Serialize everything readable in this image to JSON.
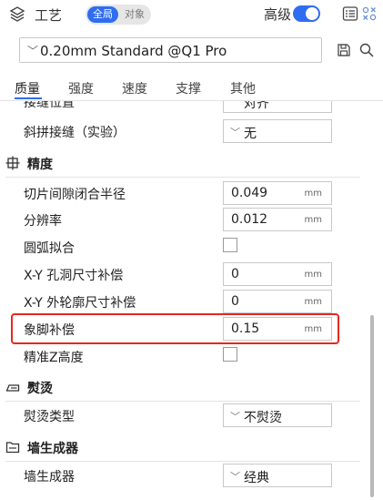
{
  "header": {
    "title": "工艺",
    "scope_options": [
      "全局",
      "对象"
    ],
    "scope_selected": "全局",
    "advanced_label": "高级",
    "advanced_enabled": true
  },
  "preset": {
    "value": "0.20mm Standard @Q1 Pro"
  },
  "tabs": [
    {
      "label": "质量",
      "active": true
    },
    {
      "label": "强度",
      "active": false
    },
    {
      "label": "速度",
      "active": false
    },
    {
      "label": "支撑",
      "active": false
    },
    {
      "label": "其他",
      "active": false
    }
  ],
  "rows": {
    "seam_position": {
      "label": "接缝位置",
      "value": "对齐"
    },
    "scarf_seam": {
      "label": "斜拼接缝（实验）",
      "value": "无"
    },
    "precision_section": "精度",
    "slice_gap_closing": {
      "label": "切片间隙闭合半径",
      "value": "0.049",
      "unit": "mm"
    },
    "resolution": {
      "label": "分辨率",
      "value": "0.012",
      "unit": "mm"
    },
    "arc_fitting": {
      "label": "圆弧拟合",
      "checked": false
    },
    "xy_hole_comp": {
      "label": "X-Y 孔洞尺寸补偿",
      "value": "0",
      "unit": "mm"
    },
    "xy_contour_comp": {
      "label": "X-Y 外轮廓尺寸补偿",
      "value": "0",
      "unit": "mm"
    },
    "elephant_foot": {
      "label": "象脚补偿",
      "value": "0.15",
      "unit": "mm"
    },
    "precise_z": {
      "label": "精准Z高度",
      "checked": false
    },
    "ironing_section": "熨烫",
    "ironing_type": {
      "label": "熨烫类型",
      "value": "不熨烫"
    },
    "wall_gen_section": "墙生成器",
    "wall_generator": {
      "label": "墙生成器",
      "value": "经典"
    }
  },
  "colors": {
    "accent": "#2f6df0",
    "highlight": "#e8271c"
  }
}
